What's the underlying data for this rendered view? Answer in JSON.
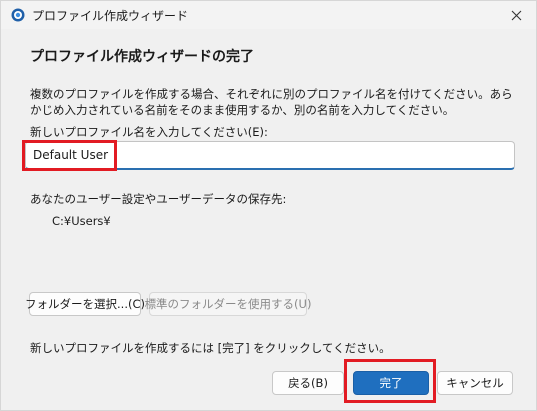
{
  "window": {
    "title": "プロファイル作成ウィザード"
  },
  "page": {
    "heading": "プロファイル作成ウィザードの完了",
    "description": "複数のプロファイルを作成する場合、それぞれに別のプロファイル名を付けてください。あらかじめ入力されている名前をそのまま使用するか、別の名前を入力してください。",
    "name_label": "新しいプロファイル名を入力してください(E):",
    "name_value": "Default User",
    "save_location_label": "あなたのユーザー設定やユーザーデータの保存先:",
    "save_location_path": "C:¥Users¥",
    "finish_note": "新しいプロファイルを作成するには [完了] をクリックしてください。"
  },
  "buttons": {
    "select_folder": "フォルダーを選択...(C)",
    "use_default_folder": "標準のフォルダーを使用する(U)",
    "back": "戻る(B)",
    "finish": "完了",
    "cancel": "キャンセル"
  },
  "colors": {
    "accent": "#1f6fbf",
    "highlight": "#e21b23"
  }
}
